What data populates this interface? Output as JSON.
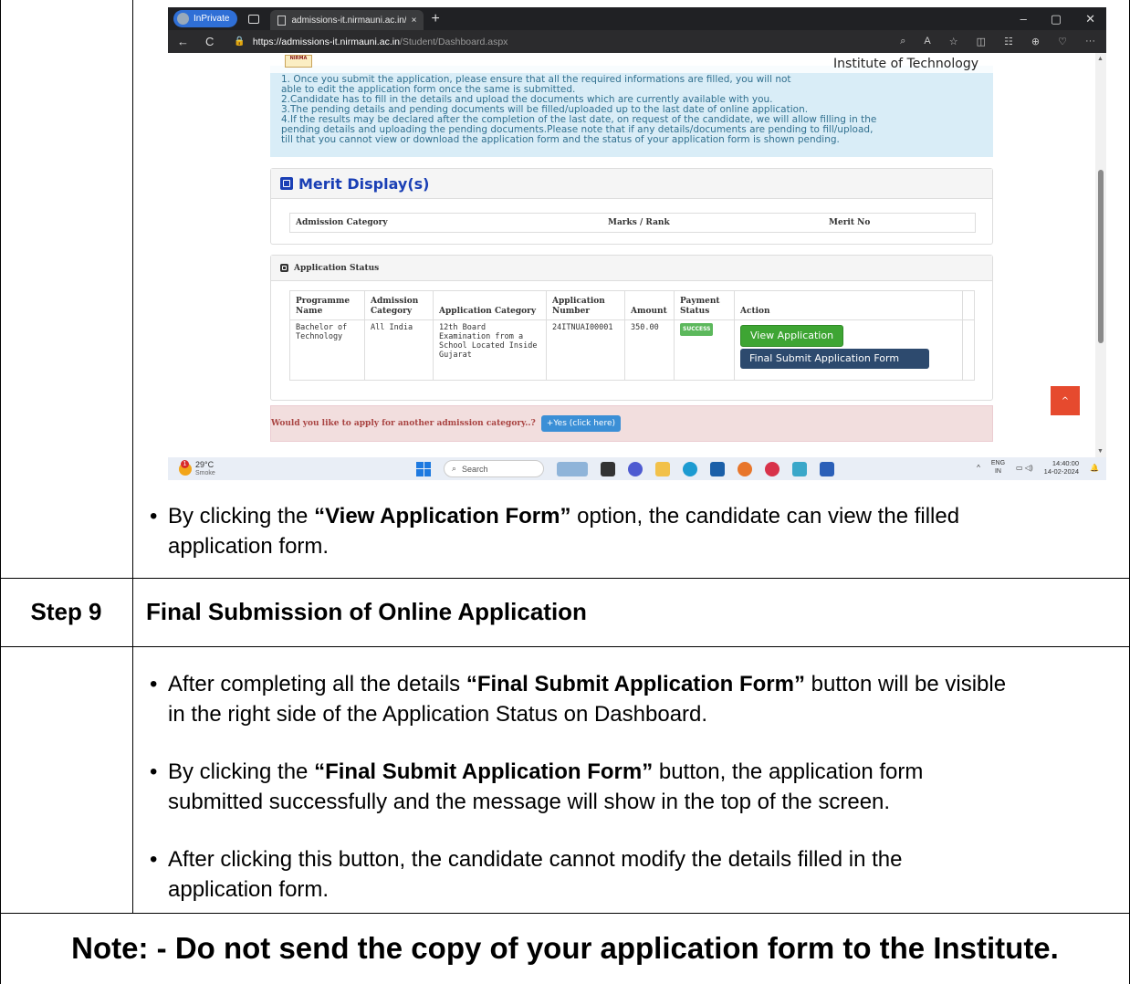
{
  "screenshot": {
    "browser": {
      "inprivate_label": "InPrivate",
      "tab_title": "admissions-it.nirmauni.ac.in/Stud",
      "tab_close": "×",
      "new_tab": "+",
      "window_controls": [
        "–",
        "▢",
        "✕"
      ],
      "nav_back": "←",
      "nav_refresh": "C",
      "url_host": "https://admissions-it.nirmauni.ac.in",
      "url_path": "/Student/Dashboard.aspx",
      "addr_icons": [
        "⌕",
        "A",
        "☆",
        "◫",
        "☷",
        "⊕",
        "♡",
        "···"
      ]
    },
    "site": {
      "logo_text": "NIRMA",
      "institute": "Institute of Technology",
      "info_lines": [
        "1. Once you submit the application, please ensure that all the required informations are filled, you will not",
        "able to edit the application form once the same is submitted.",
        "2.Candidate has to fill in the details and upload the documents which are currently available with you.",
        "3.The pending details and pending documents will be filled/uploaded up to the last date of online application.",
        "4.If the results may be declared after the completion of the last date, on request of the candidate, we will allow filling in the",
        "pending details and uploading the pending documents.Please note that if any details/documents are pending to fill/upload,",
        "till that you cannot view or download the application form and the status of your application form is shown pending."
      ],
      "merit": {
        "title": "Merit Display(s)",
        "columns": [
          "Admission Category",
          "Marks / Rank",
          "Merit No"
        ]
      },
      "status": {
        "title": "Application Status",
        "columns": [
          "Programme Name",
          "Admission Category",
          "Application Category",
          "Application Number",
          "Amount",
          "Payment Status",
          "Action"
        ],
        "row": {
          "programme": "Bachelor of Technology",
          "admission_category": "All India",
          "application_category": "12th Board Examination from a School Located Inside Gujarat",
          "application_number": "24ITNUAI00001",
          "amount": "350.00",
          "payment_status": "SUCCESS"
        },
        "view_button": "View Application",
        "final_button": "Final Submit Application Form"
      },
      "another_prompt": "Would you like to apply for another admission category..?",
      "yes_button": "+Yes (click here)",
      "to_top": "^"
    },
    "taskbar": {
      "temp": "29°C",
      "weather": "Smoke",
      "search_placeholder": "Search",
      "lang_top": "ENG",
      "lang_bottom": "IN",
      "time": "14:40:00",
      "date": "14-02-2024"
    }
  },
  "doc": {
    "bullet_view": {
      "pre": "By clicking the ",
      "bold": "“View Application Form”",
      "post": " option, the candidate can view the filled",
      "line2": "application form."
    },
    "step_label": "Step 9",
    "step_title": "Final Submission of Online Application",
    "bullet1": {
      "pre": "After completing all the details ",
      "bold": "“Final Submit Application Form”",
      "post": " button will be visible",
      "line2": "in the right side of the Application Status on Dashboard."
    },
    "bullet2": {
      "pre": "By clicking the ",
      "bold": "“Final Submit Application Form”",
      "post": " button, the application form",
      "line2": "submitted successfully and the message will show in the top of the screen."
    },
    "bullet3": {
      "line1": "After clicking this button, the candidate cannot modify the details filled in the",
      "line2": "application form."
    },
    "note": "Note: - Do not send the copy of your application form to the Institute."
  }
}
